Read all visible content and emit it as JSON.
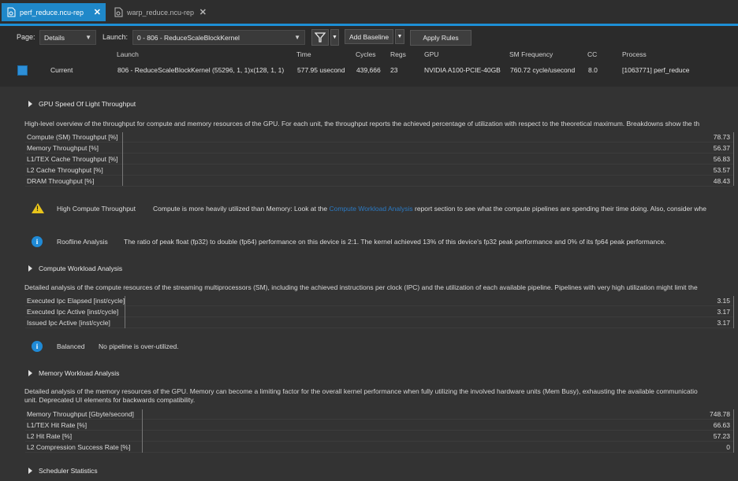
{
  "tabs": [
    {
      "label": "perf_reduce.ncu-rep",
      "active": true
    },
    {
      "label": "warp_reduce.ncu-rep",
      "active": false
    }
  ],
  "toolbar": {
    "page_label": "Page:",
    "page_value": "Details",
    "launch_label": "Launch:",
    "launch_value": "0 - 806 - ReduceScaleBlockKernel",
    "add_baseline": "Add Baseline",
    "apply_rules": "Apply Rules"
  },
  "header": {
    "cols": [
      "Launch",
      "Time",
      "Cycles",
      "Regs",
      "GPU",
      "SM Frequency",
      "CC",
      "Process"
    ],
    "current": {
      "name": "Current",
      "launch": "806 - ReduceScaleBlockKernel (55296, 1, 1)x(128, 1, 1)",
      "time": "577.95 usecond",
      "cycles": "439,666",
      "regs": "23",
      "gpu": "NVIDIA A100-PCIE-40GB",
      "sm_freq": "760.72 cycle/usecond",
      "cc": "8.0",
      "process": "[1063771] perf_reduce"
    }
  },
  "sections": {
    "sol": {
      "title": "GPU Speed Of Light Throughput",
      "desc": "High-level overview of the throughput for compute and memory resources of the GPU. For each unit, the throughput reports the achieved percentage of utilization with respect to the theoretical maximum. Breakdowns show the th",
      "metrics": [
        {
          "label": "Compute (SM) Throughput [%]",
          "value": "78.73"
        },
        {
          "label": "Memory Throughput [%]",
          "value": "56.37"
        },
        {
          "label": "L1/TEX Cache Throughput [%]",
          "value": "56.83"
        },
        {
          "label": "L2 Cache Throughput [%]",
          "value": "53.57"
        },
        {
          "label": "DRAM Throughput [%]",
          "value": "48.43"
        }
      ],
      "warn_title": "High Compute Throughput",
      "warn_text_a": "Compute is more heavily utilized than Memory: Look at the",
      "warn_link": "Compute Workload Analysis",
      "warn_text_b": "report section to see what the compute pipelines are spending their time doing. Also, consider whe",
      "info_title": "Roofline Analysis",
      "info_text": "The ratio of peak float (fp32) to double (fp64) performance on this device is 2:1. The kernel achieved 13% of this device's fp32 peak performance and 0% of its fp64 peak performance."
    },
    "compute": {
      "title": "Compute Workload Analysis",
      "desc": "Detailed analysis of the compute resources of the streaming multiprocessors (SM), including the achieved instructions per clock (IPC) and the utilization of each available pipeline. Pipelines with very high utilization might limit the",
      "metrics": [
        {
          "label": "Executed Ipc Elapsed [inst/cycle]",
          "value": "3.15"
        },
        {
          "label": "Executed Ipc Active [inst/cycle]",
          "value": "3.17"
        },
        {
          "label": "Issued Ipc Active [inst/cycle]",
          "value": "3.17"
        }
      ],
      "info_title": "Balanced",
      "info_text": "No pipeline is over-utilized."
    },
    "memory": {
      "title": "Memory Workload Analysis",
      "desc_1": "Detailed analysis of the memory resources of the GPU. Memory can become a limiting factor for the overall kernel performance when fully utilizing the involved hardware units (Mem Busy), exhausting the available communicatio",
      "desc_2": "unit. Deprecated UI elements for backwards compatibility.",
      "metrics": [
        {
          "label": "Memory Throughput [Gbyte/second]",
          "value": "748.78"
        },
        {
          "label": "L1/TEX Hit Rate [%]",
          "value": "66.63"
        },
        {
          "label": "L2 Hit Rate [%]",
          "value": "57.23"
        },
        {
          "label": "L2 Compression Success Rate [%]",
          "value": "0"
        }
      ]
    },
    "scheduler": {
      "title": "Scheduler Statistics"
    }
  },
  "colors": {
    "accent": "#1f88c9",
    "warning": "#e8c41b",
    "info": "#1f8ad6"
  },
  "icons": {
    "filter": "filter-icon",
    "close": "close-icon",
    "warning": "warning-icon",
    "info": "info-icon",
    "collapse": "collapse-triangle-icon"
  }
}
